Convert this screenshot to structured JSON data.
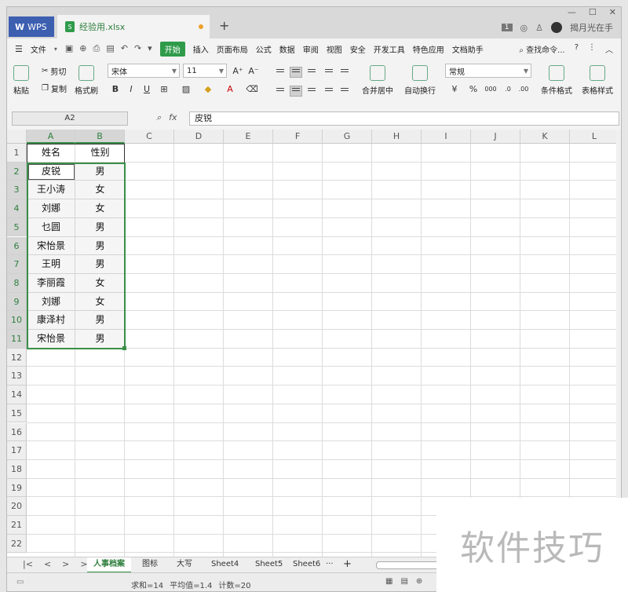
{
  "titlebar": {
    "app_tab": "WPS",
    "file_tab": "经验用.xlsx",
    "new_tab": "+",
    "badge": "1",
    "user": "揭月光在手"
  },
  "menubar": {
    "file": "文件",
    "items": [
      "开始",
      "插入",
      "页面布局",
      "公式",
      "数据",
      "审阅",
      "视图",
      "安全",
      "开发工具",
      "特色应用",
      "文档助手"
    ],
    "search": "查找命令..."
  },
  "ribbon": {
    "paste": "粘贴",
    "cut": "剪切",
    "copy": "复制",
    "format_painter": "格式刷",
    "font": "宋体",
    "size": "11",
    "merge": "合并居中",
    "wrap": "自动换行",
    "number_format": "常规",
    "cond_format": "条件格式",
    "table_style": "表格样式"
  },
  "formula_bar": {
    "name_box": "A2",
    "fx": "fx",
    "value": "皮锐"
  },
  "columns": [
    "A",
    "B",
    "C",
    "D",
    "E",
    "F",
    "G",
    "H",
    "I",
    "J",
    "K",
    "L"
  ],
  "rows": [
    "1",
    "2",
    "3",
    "4",
    "5",
    "6",
    "7",
    "8",
    "9",
    "10",
    "11",
    "12",
    "13",
    "14",
    "15",
    "16",
    "17",
    "18",
    "19",
    "20",
    "21",
    "22"
  ],
  "table": {
    "headers": [
      "姓名",
      "性别"
    ],
    "rows": [
      [
        "皮锐",
        "男"
      ],
      [
        "王小涛",
        "女"
      ],
      [
        "刘娜",
        "女"
      ],
      [
        "乜圆",
        "男"
      ],
      [
        "宋怡景",
        "男"
      ],
      [
        "王明",
        "男"
      ],
      [
        "李丽霞",
        "女"
      ],
      [
        "刘娜",
        "女"
      ],
      [
        "康泽村",
        "男"
      ],
      [
        "宋怡景",
        "男"
      ]
    ]
  },
  "sheets": {
    "tabs": [
      "人事档案",
      "图标",
      "大写",
      "Sheet4",
      "Sheet5",
      "Sheet6"
    ],
    "more": "···",
    "add": "+"
  },
  "status": {
    "sum": "求和=14",
    "avg": "平均值=1.4",
    "count": "计数=20"
  },
  "watermark": "软件技巧",
  "colors": {
    "accent": "#3a8f48",
    "wps_blue": "#3c5fb0"
  }
}
